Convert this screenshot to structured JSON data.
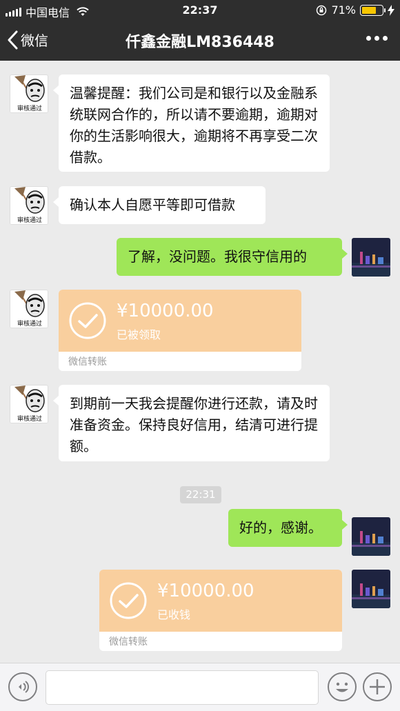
{
  "status_bar": {
    "carrier": "中国电信",
    "time": "22:37",
    "battery_percent": "71%",
    "battery_level": 0.71
  },
  "nav": {
    "back_label": "微信",
    "title": "仟鑫金融LM836448"
  },
  "avatar_caption": "审核通过",
  "messages": [
    {
      "sender": "other",
      "text": "温馨提醒：我们公司是和银行以及金融系统联网合作的，所以请不要逾期，逾期对你的生活影响很大，逾期将不再享受二次借款。"
    },
    {
      "sender": "other",
      "text": "确认本人自愿平等即可借款"
    },
    {
      "sender": "self",
      "text": "了解，没问题。我很守信用的"
    },
    {
      "sender": "other",
      "type": "transfer",
      "amount": "¥10000.00",
      "status": "已被领取",
      "label": "微信转账"
    },
    {
      "sender": "other",
      "text": "到期前一天我会提醒你进行还款，请及时准备资金。保持良好信用，结清可进行提额。"
    },
    {
      "type": "timestamp",
      "text": "22:31"
    },
    {
      "sender": "self",
      "text": "好的，感谢。"
    },
    {
      "sender": "self",
      "type": "transfer",
      "amount": "¥10000.00",
      "status": "已收钱",
      "label": "微信转账"
    }
  ],
  "colors": {
    "header_bg": "#2e2e2e",
    "chat_bg": "#ebebeb",
    "self_bubble": "#9fe658",
    "transfer_card": "#f9cf9e"
  },
  "icons": {
    "voice": "voice-icon",
    "emoji": "emoji-icon",
    "plus": "plus-icon",
    "more": "more-icon",
    "back": "chevron-left-icon"
  }
}
